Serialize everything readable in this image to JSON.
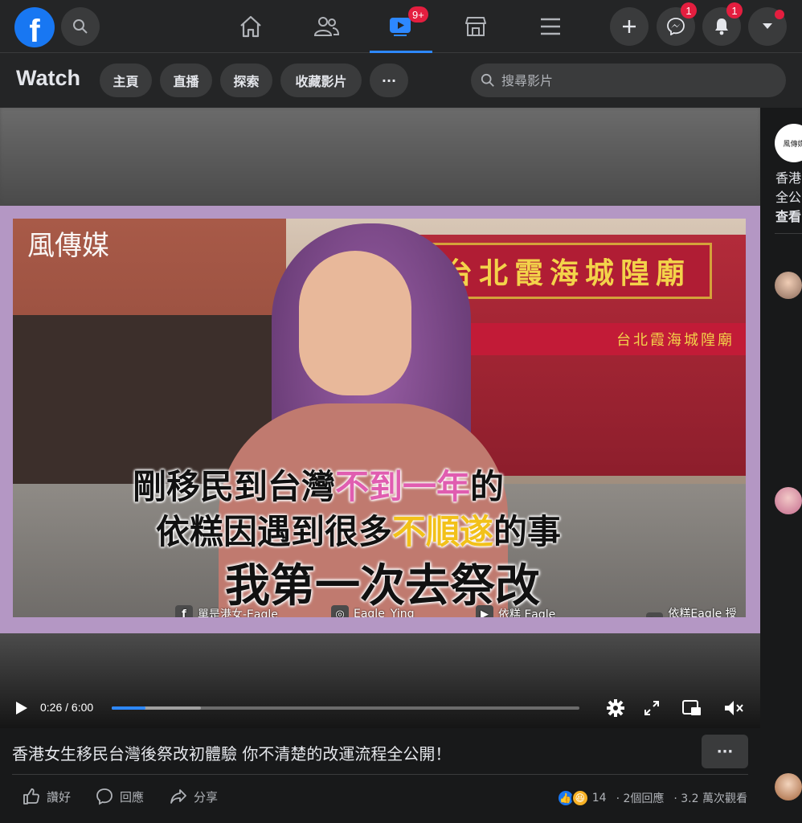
{
  "topbar": {
    "video_badge": "9+",
    "messenger_badge": "1",
    "notifications_badge": "1"
  },
  "watch": {
    "title": "Watch",
    "tabs": [
      "主頁",
      "直播",
      "探索",
      "收藏影片"
    ],
    "more": "···",
    "search_placeholder": "搜尋影片"
  },
  "video": {
    "watermark": "風傳媒",
    "subtitle_line1_a": "剛移民到台灣",
    "subtitle_line1_b": "不到一年",
    "subtitle_line1_c": "的",
    "subtitle_line2_a": "依糕因遇到很多",
    "subtitle_line2_b": "不順遂",
    "subtitle_line2_c": "的事",
    "subtitle_line3": "我第一次去祭改",
    "temple_sign": "台北霞海城隍廟",
    "awning_text": "台北霞海城隍廟",
    "social_fb": "單是港女-Eagle",
    "social_ig": "Eagle_Ying",
    "social_yt": "依糕 Eagle",
    "credit": "依糕Eagle 授權",
    "time_current": "0:26",
    "time_total": "6:00",
    "progress_played": 0.072,
    "progress_buffered": 0.19
  },
  "post": {
    "title": "香港女生移民台灣後祭改初體驗 你不清楚的改運流程全公開！",
    "more": "···",
    "like": "讚好",
    "comment": "回應",
    "share": "分享",
    "reaction_count": "14",
    "comments_count": "· 2個回應",
    "views": "· 3.2 萬次觀看"
  },
  "sidebar": {
    "page_name_1": "香港",
    "page_name_2": "全公",
    "see_more": "查看",
    "logo_text": "風傳媒"
  },
  "colors": {
    "accent": "#2d88ff",
    "badge": "#e41e3f",
    "frame": "#b497c4"
  }
}
